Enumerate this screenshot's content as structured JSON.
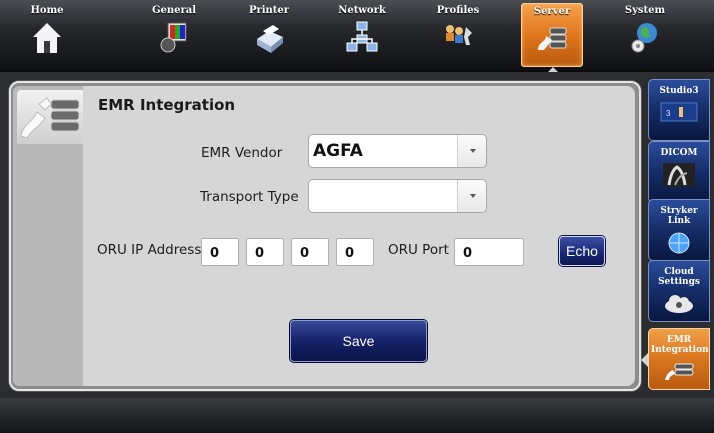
{
  "topnav": {
    "tabs": [
      {
        "label": "Home",
        "icon": "home-icon"
      },
      {
        "label": "General",
        "icon": "general-icon"
      },
      {
        "label": "Printer",
        "icon": "printer-icon"
      },
      {
        "label": "Network",
        "icon": "network-icon"
      },
      {
        "label": "Profiles",
        "icon": "profiles-icon"
      },
      {
        "label": "Server",
        "icon": "server-icon",
        "active": true
      },
      {
        "label": "System",
        "icon": "system-icon"
      }
    ]
  },
  "panel": {
    "title": "EMR Integration",
    "emr_vendor": {
      "label": "EMR Vendor",
      "value": "AGFA"
    },
    "transport_type": {
      "label": "Transport Type",
      "value": ""
    },
    "oru_ip": {
      "label": "ORU IP Address",
      "octets": [
        "0",
        "0",
        "0",
        "0"
      ]
    },
    "oru_port": {
      "label": "ORU Port",
      "value": "0"
    },
    "echo_label": "Echo",
    "save_label": "Save"
  },
  "sidetabs": [
    {
      "label": "Studio3",
      "icon": "studio3-icon"
    },
    {
      "label": "DICOM",
      "icon": "dicom-icon"
    },
    {
      "label": "Stryker Link",
      "icon": "stryker-link-icon"
    },
    {
      "label": "Cloud Settings",
      "icon": "cloud-settings-icon"
    },
    {
      "label": "EMR Integration",
      "icon": "emr-integration-icon",
      "active": true
    }
  ],
  "colors": {
    "active": "#e0761c",
    "button": "#15226a",
    "sidetab": "#142a63"
  }
}
